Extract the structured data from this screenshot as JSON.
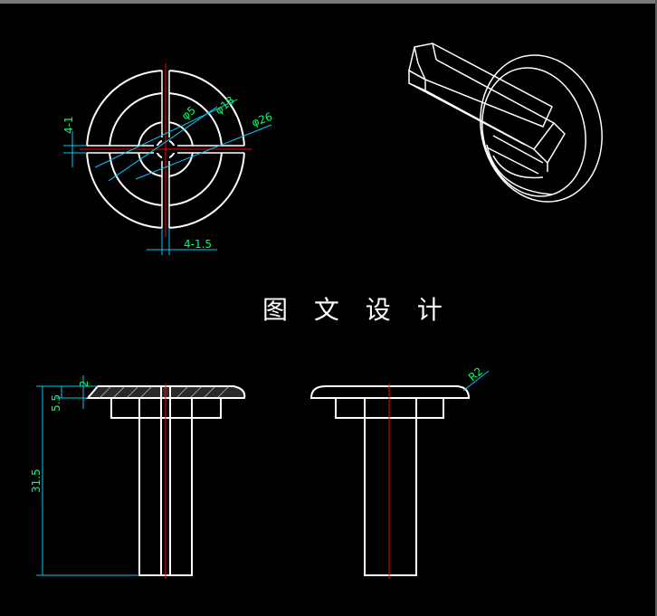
{
  "title": "图 文 设 计",
  "colors": {
    "background": "#000000",
    "outline": "#ffffff",
    "dimension": "#00ccff",
    "dimension_text": "#00ff66",
    "center_line": "#ff0000"
  },
  "front_view": {
    "dims": {
      "slot_width": "4-1",
      "dia_outer": "φ26",
      "dia_mid": "φ18",
      "dia_inner": "φ5",
      "slot_bottom": "4-1.5"
    }
  },
  "side_view": {
    "dims": {
      "cap_height": "2",
      "flange_height": "5.5",
      "total_height": "31.5"
    }
  },
  "section_view": {
    "dims": {
      "radius": "R2"
    }
  }
}
